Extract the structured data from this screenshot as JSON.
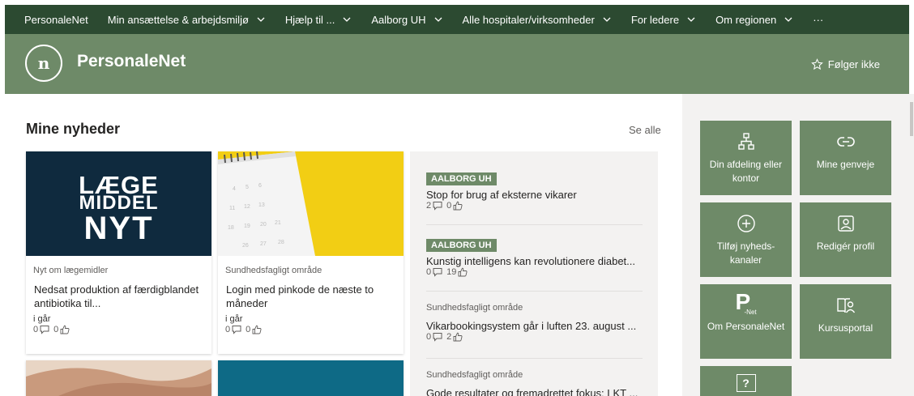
{
  "topnav": {
    "items": [
      {
        "label": "PersonaleNet",
        "dropdown": false
      },
      {
        "label": "Min ansættelse & arbejdsmiljø",
        "dropdown": true
      },
      {
        "label": "Hjælp til ...",
        "dropdown": true
      },
      {
        "label": "Aalborg UH",
        "dropdown": true
      },
      {
        "label": "Alle hospitaler/virksomheder",
        "dropdown": true
      },
      {
        "label": "For ledere",
        "dropdown": true
      },
      {
        "label": "Om regionen",
        "dropdown": true
      },
      {
        "label": "···",
        "dropdown": false
      }
    ]
  },
  "header": {
    "logo_text": "n",
    "title": "PersonaleNet",
    "follow_label": "Følger ikke"
  },
  "news": {
    "section_title": "Mine nyheder",
    "see_all": "Se alle",
    "cards": [
      {
        "thumb_lines": [
          "LÆGE",
          "MIDDEL",
          "NYT"
        ],
        "category": "Nyt om lægemidler",
        "headline": "Nedsat produktion af færdigblandet antibiotika til...",
        "time": "i går",
        "comments": "0",
        "likes": "0"
      },
      {
        "category": "Sundhedsfagligt område",
        "headline": "Login med pinkode de næste to måneder",
        "time": "i går",
        "comments": "0",
        "likes": "0"
      }
    ],
    "list": [
      {
        "badge": "AALBORG UH",
        "title": "Stop for brug af eksterne vikarer",
        "comments": "2",
        "likes": "0"
      },
      {
        "badge": "AALBORG UH",
        "title": "Kunstig intelligens kan revolutionere diabet...",
        "comments": "0",
        "likes": "19"
      },
      {
        "category": "Sundhedsfagligt område",
        "title": "Vikarbookingsystem går i luften 23. august ...",
        "comments": "0",
        "likes": "2"
      },
      {
        "category": "Sundhedsfagligt område",
        "title": "Gode resultater og fremadrettet fokus: LKT ..."
      }
    ]
  },
  "quicklinks": {
    "tiles": [
      {
        "label": "Din afdeling eller kontor",
        "icon": "org-chart-icon"
      },
      {
        "label": "Mine genveje",
        "icon": "link-icon"
      },
      {
        "label": "Tilføj nyheds-kanaler",
        "icon": "add-circle-icon"
      },
      {
        "label": "Redigér profil",
        "icon": "image-icon"
      },
      {
        "label": "Om PersonaleNet",
        "icon": "p-net-icon",
        "icon_text": "P",
        "icon_subtext": "-Net"
      },
      {
        "label": "Kursusportal",
        "icon": "book-person-icon"
      },
      {
        "label": "",
        "icon": "question-icon",
        "icon_text": "?"
      }
    ]
  },
  "colors": {
    "topnav_bg": "#2c4a31",
    "header_bg": "#6e8a68",
    "tile_bg": "#6e8a68",
    "badge_bg": "#6e8a68",
    "panel_bg": "#f3f2f1"
  }
}
